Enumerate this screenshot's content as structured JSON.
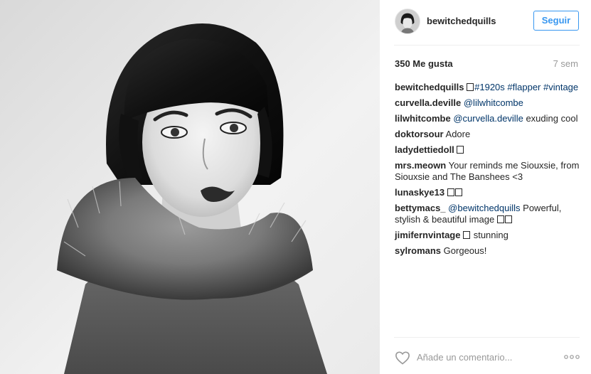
{
  "post": {
    "username": "bewitchedquills",
    "follow_label": "Seguir",
    "likes": "350 Me gusta",
    "time": "7 sem",
    "add_comment_placeholder": "Añade un comentario...",
    "comments": [
      {
        "user": "bewitchedquills",
        "pre": "",
        "tags": "#1920s #flapper #vintage",
        "text": "",
        "boxes": 1,
        "boxes_pos": "before_tags"
      },
      {
        "user": "curvella.deville",
        "tags": "@lilwhitcombe",
        "text": ""
      },
      {
        "user": "lilwhitcombe",
        "tags": "@curvella.deville",
        "text": "exuding cool"
      },
      {
        "user": "doktorsour",
        "tags": "",
        "text": "Adore"
      },
      {
        "user": "ladydettiedoll",
        "tags": "",
        "text": "",
        "boxes": 1
      },
      {
        "user": "mrs.meown",
        "tags": "",
        "text": "Your reminds me Siouxsie, from Siouxsie and The Banshees <3"
      },
      {
        "user": "lunaskye13",
        "tags": "",
        "text": "",
        "boxes": 2
      },
      {
        "user": "bettymacs_",
        "tags": "@bewitchedquills",
        "text": "Powerful, stylish & beautiful image",
        "boxes_after": 2
      },
      {
        "user": "jimifernvintage",
        "tags": "",
        "text": "stunning",
        "boxes": 1
      },
      {
        "user": "sylromans",
        "tags": "",
        "text": "Gorgeous!"
      }
    ]
  },
  "icons": {
    "heart": "heart-icon",
    "more": "more-options-icon"
  },
  "colors": {
    "link": "#003569",
    "follow": "#3897f0",
    "muted": "#999999"
  }
}
